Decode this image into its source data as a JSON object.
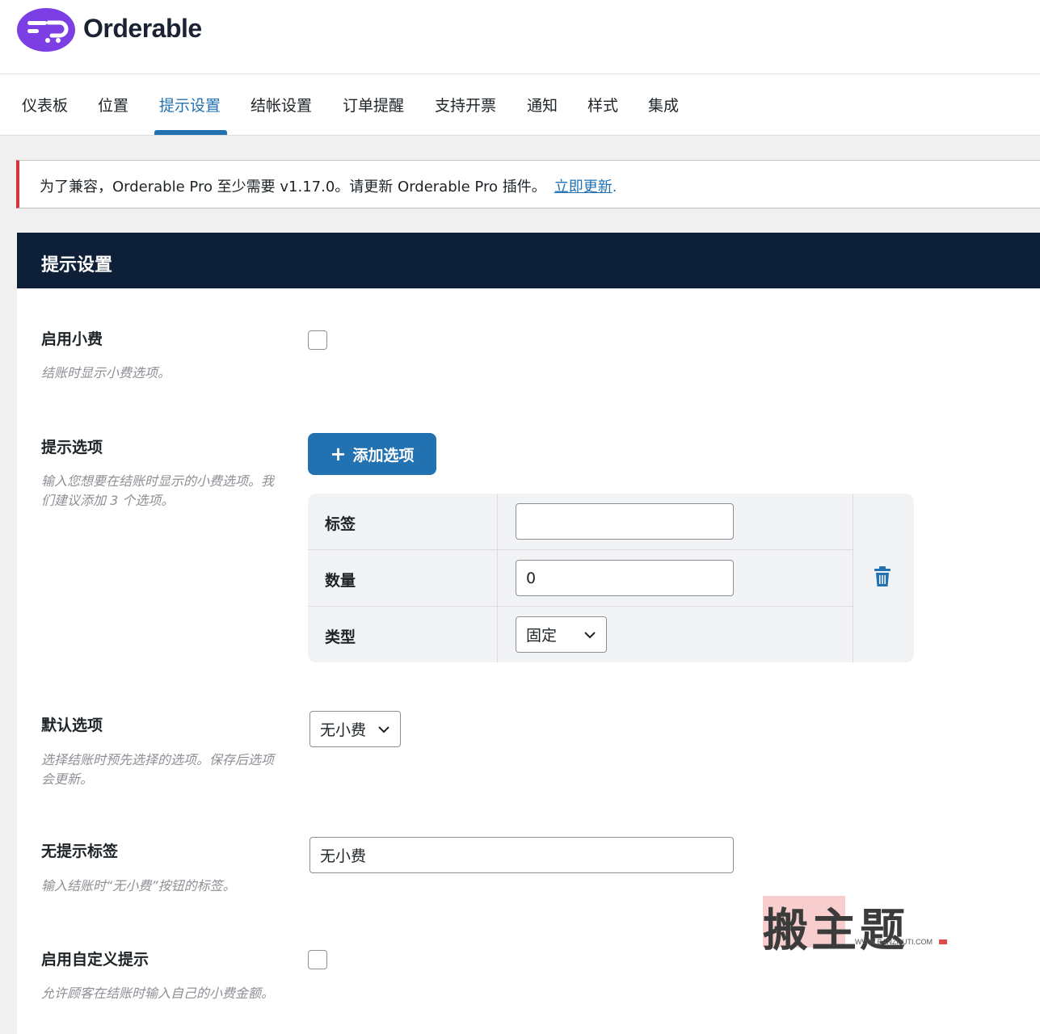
{
  "brand": {
    "name": "Orderable",
    "accent": "#7b3fe4"
  },
  "tabs": [
    {
      "label": "仪表板"
    },
    {
      "label": "位置"
    },
    {
      "label": "提示设置",
      "active": true
    },
    {
      "label": "结帐设置"
    },
    {
      "label": "订单提醒"
    },
    {
      "label": "支持开票"
    },
    {
      "label": "通知"
    },
    {
      "label": "样式"
    },
    {
      "label": "集成"
    }
  ],
  "notice": {
    "text": "为了兼容，Orderable Pro 至少需要 v1.17.0。请更新 Orderable Pro 插件。",
    "link": "立即更新",
    "suffix": "."
  },
  "panel": {
    "title": "提示设置",
    "enable_tips": {
      "label": "启用小费",
      "desc": "结账时显示小费选项。",
      "checked": false
    },
    "tip_options": {
      "label": "提示选项",
      "desc": "输入您想要在结账时显示的小费选项。我们建议添加 3 个选项。",
      "add_button": "添加选项",
      "rows": [
        {
          "label": "标签",
          "value": ""
        },
        {
          "label": "数量",
          "value": "0"
        },
        {
          "label": "类型",
          "value": "固定"
        }
      ]
    },
    "default_option": {
      "label": "默认选项",
      "desc": "选择结账时预先选择的选项。保存后选项会更新。",
      "value": "无小费"
    },
    "no_tip_label": {
      "label": "无提示标签",
      "desc": "输入结账时“无小费”按钮的标签。",
      "value": "无小费"
    },
    "custom_tip": {
      "label": "启用自定义提示",
      "desc": "允许顾客在结账时输入自己的小费金额。",
      "checked": false
    }
  },
  "watermark": {
    "main": "搬主题",
    "url": "WWW.BANZHUTI.COM"
  },
  "icons": {
    "add": "plus-icon",
    "delete": "trash-icon",
    "dropdown": "chevron-down-icon"
  }
}
